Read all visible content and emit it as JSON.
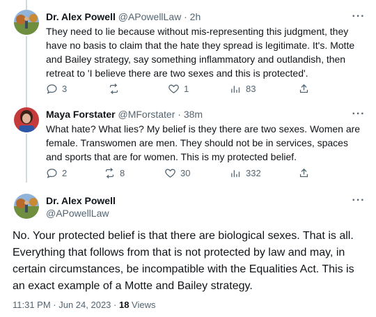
{
  "tweets": [
    {
      "name": "Dr. Alex Powell",
      "handle": "@APowellLaw",
      "time": "· 2h",
      "text": "They need to lie because without mis-representing this judgment, they have no basis to claim that the hate they spread is legitimate. It's. Motte and Bailey strategy, say something inflammatory and outlandish, then retreat to 'I believe there are two sexes and this is protected'.",
      "replies": "3",
      "retweets": "",
      "likes": "1",
      "views": "83"
    },
    {
      "name": "Maya Forstater",
      "handle": "@MForstater",
      "time": "· 38m",
      "text": "What hate? What lies? My belief is they there are two sexes. Women are female. Transwomen are men. They should not be in services, spaces and sports that are for women. This is my protected belief.",
      "replies": "2",
      "retweets": "8",
      "likes": "30",
      "views": "332"
    }
  ],
  "main_tweet": {
    "name": "Dr. Alex Powell",
    "handle": "@APowellLaw",
    "text": "No. Your protected belief is that there are biological sexes. That is all. Everything that follows from that is not protected by law and may, in certain circumstances, be incompatible with the Equalities Act. This is an exact example of a Motte and Bailey strategy.",
    "timestamp": "11:31 PM · Jun 24, 2023 · ",
    "views_count": "18",
    "views_label": " Views"
  },
  "icons": {
    "reply": "reply-icon",
    "retweet": "retweet-icon",
    "like": "heart-icon",
    "views": "views-icon",
    "share": "share-icon",
    "more": "more-icon"
  }
}
